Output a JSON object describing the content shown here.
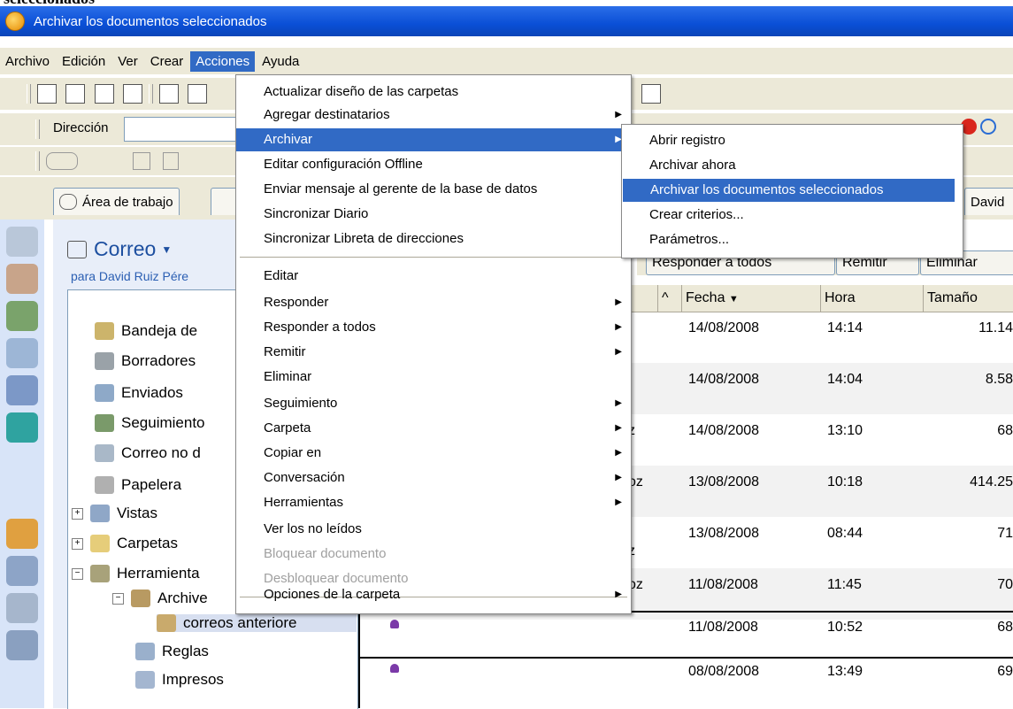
{
  "top_text": "seleccionados",
  "window": {
    "title": "Archivar los documentos seleccionados"
  },
  "menubar": [
    "Archivo",
    "Edición",
    "Ver",
    "Crear",
    "Acciones",
    "Ayuda"
  ],
  "address": {
    "label": "Dirección"
  },
  "tabs": {
    "workspace": "Área de trabajo",
    "right": "David"
  },
  "mail": {
    "title": "Correo",
    "subtitle": "para David Ruiz Pére"
  },
  "folders": [
    {
      "label": "Bandeja de"
    },
    {
      "label": "Borradores"
    },
    {
      "label": "Enviados"
    },
    {
      "label": "Seguimiento"
    },
    {
      "label": "Correo no d"
    },
    {
      "label": "Papelera"
    },
    {
      "label": "Vistas"
    },
    {
      "label": "Carpetas"
    },
    {
      "label": "Herramienta"
    },
    {
      "label": "Archive"
    },
    {
      "label": "correos anteriore"
    },
    {
      "label": "Reglas"
    },
    {
      "label": "Impresos"
    }
  ],
  "buttons": {
    "reply_all": "Responder a todos",
    "forward": "Remitir",
    "delete": "Eliminar"
  },
  "columns": {
    "fecha": "Fecha",
    "hora": "Hora",
    "tamano": "Tamaño"
  },
  "rows": [
    {
      "frag": "",
      "fecha": "14/08/2008",
      "hora": "14:14",
      "size": "11.14"
    },
    {
      "frag": "",
      "fecha": "14/08/2008",
      "hora": "14:04",
      "size": "8.58"
    },
    {
      "frag": "z",
      "fecha": "14/08/2008",
      "hora": "13:10",
      "size": "68"
    },
    {
      "frag": "oz",
      "fecha": "13/08/2008",
      "hora": "10:18",
      "size": "414.25"
    },
    {
      "frag": "z",
      "fecha": "13/08/2008",
      "hora": "08:44",
      "size": "71"
    },
    {
      "frag": "oz",
      "fecha": "11/08/2008",
      "hora": "11:45",
      "size": "70"
    },
    {
      "frag": "",
      "fecha": "11/08/2008",
      "hora": "10:52",
      "size": "68"
    },
    {
      "frag": "",
      "fecha": "08/08/2008",
      "hora": "13:49",
      "size": "69"
    }
  ],
  "acciones_menu": [
    "Actualizar diseño de las carpetas",
    "Agregar destinatarios",
    "Archivar",
    "Editar configuración Offline",
    "Enviar mensaje al gerente de la base de datos",
    "Sincronizar Diario",
    "Sincronizar Libreta de direcciones",
    "Editar",
    "Responder",
    "Responder a todos",
    "Remitir",
    "Eliminar",
    "Seguimiento",
    "Carpeta",
    "Copiar en",
    "Conversación",
    "Herramientas",
    "Ver los no leídos",
    "Bloquear documento",
    "Desbloquear documento",
    "Opciones de la carpeta"
  ],
  "archivar_submenu": [
    "Abrir registro",
    "Archivar ahora",
    "Archivar los documentos seleccionados",
    "Crear criterios...",
    "Parámetros..."
  ],
  "colors": {
    "titlebar": "#0a4fd6",
    "highlight": "#316ac5",
    "chrome": "#ece9d8"
  }
}
